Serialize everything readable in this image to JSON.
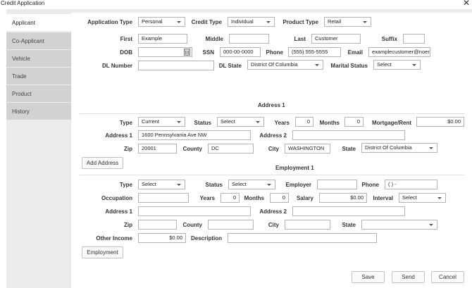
{
  "window": {
    "title": "Credit Application",
    "close_glyph": "✕"
  },
  "sidebar": {
    "items": [
      {
        "label": "Applicant"
      },
      {
        "label": "Co-Applicant"
      },
      {
        "label": "Vehicle"
      },
      {
        "label": "Trade"
      },
      {
        "label": "Product"
      },
      {
        "label": "History"
      }
    ]
  },
  "applicant": {
    "application_type_label": "Application Type",
    "application_type": "Personal",
    "credit_type_label": "Credit Type",
    "credit_type": "Individual",
    "product_type_label": "Product Type",
    "product_type": "Retail",
    "first_label": "First",
    "first": "Example",
    "middle_label": "Middle",
    "middle": "",
    "last_label": "Last",
    "last": "Customer",
    "suffix_label": "Suffix",
    "suffix": "",
    "dob_label": "DOB",
    "dob": "",
    "ssn_label": "SSN",
    "ssn": "000-00-0000",
    "phone_label": "Phone",
    "phone": "(555) 555-5555",
    "email_label": "Email",
    "email": "examplecustomer@noen",
    "dl_number_label": "DL Number",
    "dl_number": "",
    "dl_state_label": "DL State",
    "dl_state": "District Of Columbia",
    "marital_status_label": "Marital Status",
    "marital_status": "Select"
  },
  "address1": {
    "title": "Address 1",
    "type_label": "Type",
    "type": "Current",
    "status_label": "Status",
    "status": "Select",
    "years_label": "Years",
    "years": "0",
    "months_label": "Months",
    "months": "0",
    "mortgage_label": "Mortgage/Rent",
    "mortgage": "$0.00",
    "address1_label": "Address 1",
    "address1": "1600 Pennsylvania Ave NW",
    "address2_label": "Address 2",
    "address2": "",
    "zip_label": "Zip",
    "zip": "20001",
    "county_label": "County",
    "county": "DC",
    "city_label": "City",
    "city": "WASHINGTON",
    "state_label": "State",
    "state": "District Of Columbia",
    "add_button": "Add Address"
  },
  "employment1": {
    "title": "Employment 1",
    "type_label": "Type",
    "type": "Select",
    "status_label": "Status",
    "status": "Select",
    "employer_label": "Employer",
    "employer": "",
    "phone_label": "Phone",
    "phone": "(  )   -",
    "occupation_label": "Occupation",
    "occupation": "",
    "years_label": "Years",
    "years": "0",
    "months_label": "Months",
    "months": "0",
    "salary_label": "Salary",
    "salary": "$0.00",
    "interval_label": "Interval",
    "interval": "Select",
    "address1_label": "Address 1",
    "address1": "",
    "address2_label": "Address 2",
    "address2": "",
    "zip_label": "Zip",
    "zip": "",
    "county_label": "County",
    "county": "",
    "city_label": "City",
    "city": "",
    "state_label": "State",
    "state": "",
    "other_income_label": "Other Income",
    "other_income": "$0.00",
    "description_label": "Description",
    "description": "",
    "button": "Employment"
  },
  "footer": {
    "save": "Save",
    "send": "Send",
    "cancel": "Cancel"
  }
}
